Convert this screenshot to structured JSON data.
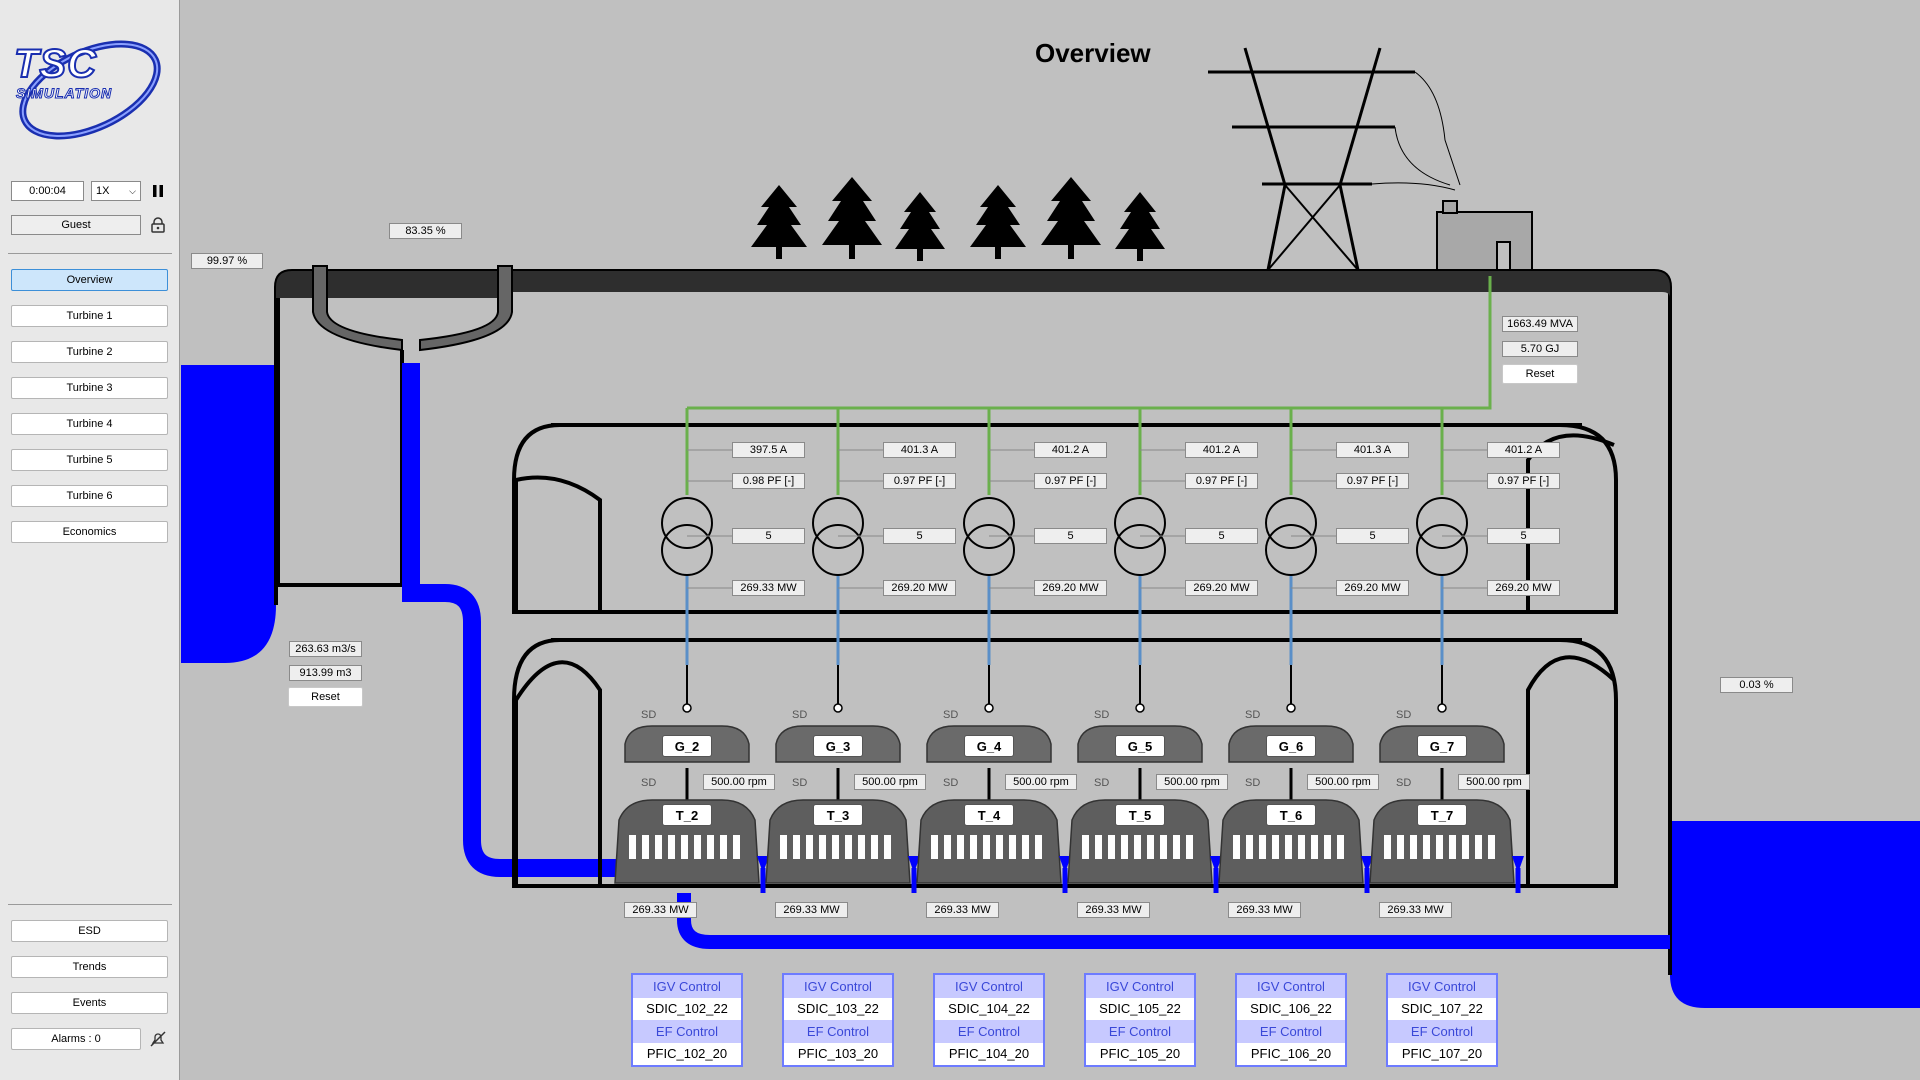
{
  "title": "Overview",
  "colors": {
    "water": "#0000ff",
    "grid_line": "#6ab04c",
    "rock": "#2a2a2a",
    "ctl_border": "#6d7bff",
    "ctl_header": "#c7c9ff"
  },
  "sidebar": {
    "logo_text": "TSC",
    "logo_sub": "SIMULATION",
    "time": "0:00:04",
    "speed": "1X",
    "user": "Guest",
    "nav": [
      "Overview",
      "Turbine 1",
      "Turbine 2",
      "Turbine 3",
      "Turbine 4",
      "Turbine 5",
      "Turbine 6",
      "Economics"
    ],
    "bottom": [
      "ESD",
      "Trends",
      "Events"
    ],
    "alarms": "Alarms : 0"
  },
  "reservoir": {
    "level_upper": "99.97 %",
    "gate": "83.35 %",
    "flow": "263.63 m3/s",
    "volume": "913.99 m3",
    "reset": "Reset"
  },
  "tailwater": {
    "level": "0.03 %"
  },
  "grid": {
    "mva": "1663.49 MVA",
    "energy": "5.70 GJ",
    "reset": "Reset"
  },
  "units": [
    {
      "current": "397.5 A",
      "pf": "0.98  PF [-]",
      "tap": "5",
      "power": "269.33 MW",
      "gen": "G_2",
      "turb": "T_2",
      "rpm": "500.00 rpm",
      "outflow": "269.33 MW",
      "igv": "SDIC_102_22",
      "ef": "PFIC_102_20"
    },
    {
      "current": "401.3 A",
      "pf": "0.97  PF [-]",
      "tap": "5",
      "power": "269.20 MW",
      "gen": "G_3",
      "turb": "T_3",
      "rpm": "500.00 rpm",
      "outflow": "269.33 MW",
      "igv": "SDIC_103_22",
      "ef": "PFIC_103_20"
    },
    {
      "current": "401.2 A",
      "pf": "0.97  PF [-]",
      "tap": "5",
      "power": "269.20 MW",
      "gen": "G_4",
      "turb": "T_4",
      "rpm": "500.00 rpm",
      "outflow": "269.33 MW",
      "igv": "SDIC_104_22",
      "ef": "PFIC_104_20"
    },
    {
      "current": "401.2 A",
      "pf": "0.97  PF [-]",
      "tap": "5",
      "power": "269.20 MW",
      "gen": "G_5",
      "turb": "T_5",
      "rpm": "500.00 rpm",
      "outflow": "269.33 MW",
      "igv": "SDIC_105_22",
      "ef": "PFIC_105_20"
    },
    {
      "current": "401.3 A",
      "pf": "0.97  PF [-]",
      "tap": "5",
      "power": "269.20 MW",
      "gen": "G_6",
      "turb": "T_6",
      "rpm": "500.00 rpm",
      "outflow": "269.33 MW",
      "igv": "SDIC_106_22",
      "ef": "PFIC_106_20"
    },
    {
      "current": "401.2 A",
      "pf": "0.97  PF [-]",
      "tap": "5",
      "power": "269.20 MW",
      "gen": "G_7",
      "turb": "T_7",
      "rpm": "500.00 rpm",
      "outflow": "269.33 MW",
      "igv": "SDIC_107_22",
      "ef": "PFIC_107_20"
    }
  ],
  "labels": {
    "sd": "SD",
    "igv_control": "IGV Control",
    "ef_control": "EF Control"
  }
}
